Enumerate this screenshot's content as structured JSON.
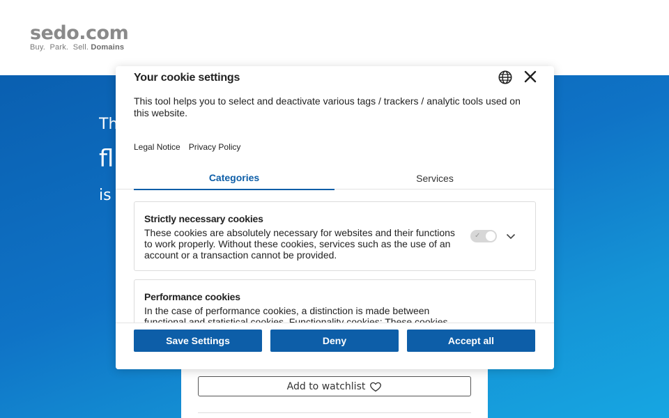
{
  "site": {
    "logo_main": "sedo.com",
    "logo_sub_plain": "Buy.  Park.  Sell.",
    "logo_sub_bold": "Domains",
    "hero_line1": "Th",
    "hero_line2": "fl",
    "hero_line3": "is",
    "watchlist_label": "Add to watchlist",
    "colors": {
      "hero": "#0f73c6",
      "primary": "#0d5ea8"
    }
  },
  "cookie_modal": {
    "title": "Your cookie settings",
    "description": "This tool helps you to select and deactivate various tags / trackers / analytic tools used on this website.",
    "links": {
      "legal_notice": "Legal Notice",
      "privacy_policy": "Privacy Policy"
    },
    "tabs": [
      {
        "label": "Categories",
        "active": true
      },
      {
        "label": "Services",
        "active": false
      }
    ],
    "categories": [
      {
        "title": "Strictly necessary cookies",
        "description": "These cookies are absolutely necessary for websites and their functions to work properly. Without these cookies, services such as the use of an account or a transaction cannot be provided.",
        "enabled": true,
        "locked": true
      },
      {
        "title": "Performance cookies",
        "description": "In the case of performance cookies, a distinction is made between functional and statistical cookies. Functionality cookies: These cookies"
      }
    ],
    "buttons": {
      "save": "Save Settings",
      "deny": "Deny",
      "accept": "Accept all"
    }
  }
}
